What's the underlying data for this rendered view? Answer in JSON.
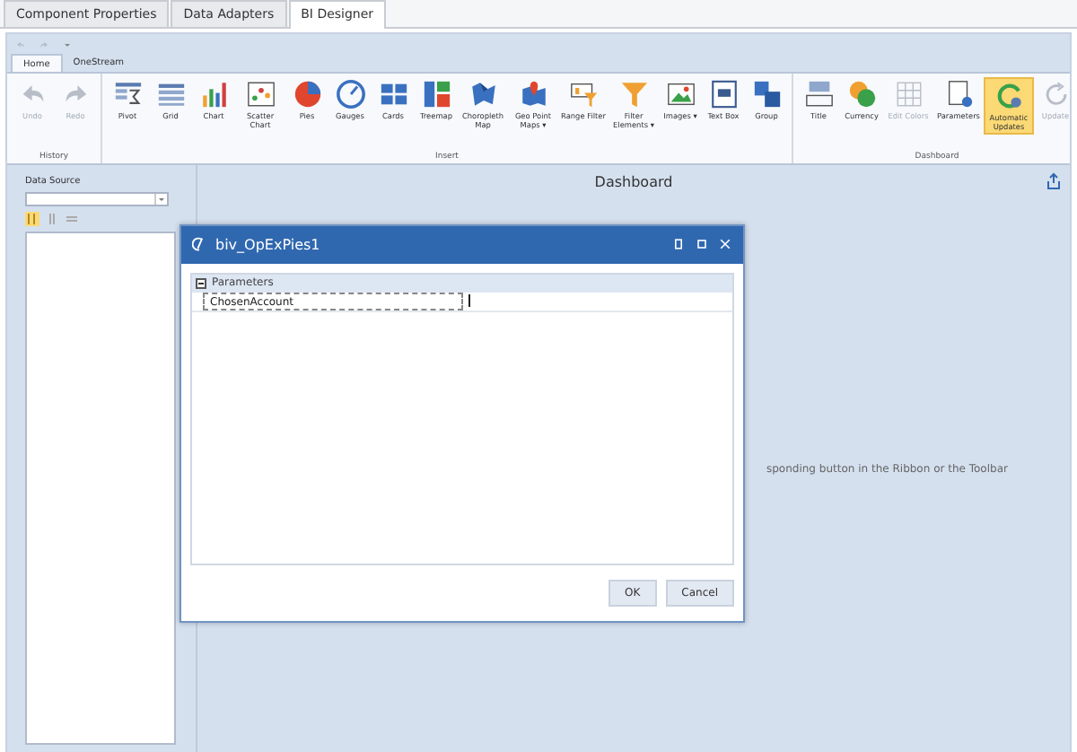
{
  "doc_tabs": [
    {
      "label": "Component Properties",
      "selected": false
    },
    {
      "label": "Data Adapters",
      "selected": false
    },
    {
      "label": "BI Designer",
      "selected": true
    }
  ],
  "ribbon_tabs": [
    {
      "label": "Home",
      "selected": true
    },
    {
      "label": "OneStream",
      "selected": false
    }
  ],
  "ribbon_groups": [
    {
      "title": "History",
      "items": [
        {
          "kind": "undo",
          "label": "Undo",
          "disabled": true,
          "on": false
        },
        {
          "kind": "redo",
          "label": "Redo",
          "disabled": true,
          "on": false
        }
      ]
    },
    {
      "title": "Insert",
      "items": [
        {
          "kind": "pivot",
          "label": "Pivot",
          "disabled": false,
          "on": false
        },
        {
          "kind": "grid",
          "label": "Grid",
          "disabled": false,
          "on": false
        },
        {
          "kind": "chart",
          "label": "Chart",
          "disabled": false,
          "on": false
        },
        {
          "kind": "scatter",
          "label": "Scatter Chart",
          "disabled": false,
          "on": false
        },
        {
          "kind": "pie",
          "label": "Pies",
          "disabled": false,
          "on": false
        },
        {
          "kind": "gauge",
          "label": "Gauges",
          "disabled": false,
          "on": false
        },
        {
          "kind": "cards",
          "label": "Cards",
          "disabled": false,
          "on": false
        },
        {
          "kind": "treemap",
          "label": "Treemap",
          "disabled": false,
          "on": false
        },
        {
          "kind": "map",
          "label": "Choropleth Map",
          "disabled": false,
          "on": false
        },
        {
          "kind": "pin",
          "label": "Geo Point Maps ▾",
          "disabled": false,
          "on": false
        },
        {
          "kind": "range",
          "label": "Range Filter",
          "disabled": false,
          "on": false
        },
        {
          "kind": "filter",
          "label": "Filter Elements ▾",
          "disabled": false,
          "on": false
        },
        {
          "kind": "image",
          "label": "Images ▾",
          "disabled": false,
          "on": false
        },
        {
          "kind": "textbox",
          "label": "Text Box",
          "disabled": false,
          "on": false
        },
        {
          "kind": "group",
          "label": "Group",
          "disabled": false,
          "on": false
        }
      ]
    },
    {
      "title": "Dashboard",
      "items": [
        {
          "kind": "title",
          "label": "Title",
          "disabled": false,
          "on": false
        },
        {
          "kind": "currency",
          "label": "Currency",
          "disabled": false,
          "on": false
        },
        {
          "kind": "colors",
          "label": "Edit Colors",
          "disabled": true,
          "on": false
        },
        {
          "kind": "parameters",
          "label": "Parameters",
          "disabled": false,
          "on": false
        },
        {
          "kind": "auto",
          "label": "Automatic Updates",
          "disabled": false,
          "on": true
        },
        {
          "kind": "update",
          "label": "Update",
          "disabled": true,
          "on": false
        }
      ]
    }
  ],
  "data_source": {
    "label": "Data Source"
  },
  "dashboard": {
    "title": "Dashboard",
    "hint": "sponding button in the Ribbon or the Toolbar"
  },
  "dialog": {
    "title": "biv_OpExPies1",
    "category": "Parameters",
    "rows": [
      {
        "name": "ChosenAccount",
        "value": ""
      }
    ],
    "buttons": [
      "OK",
      "Cancel"
    ]
  }
}
